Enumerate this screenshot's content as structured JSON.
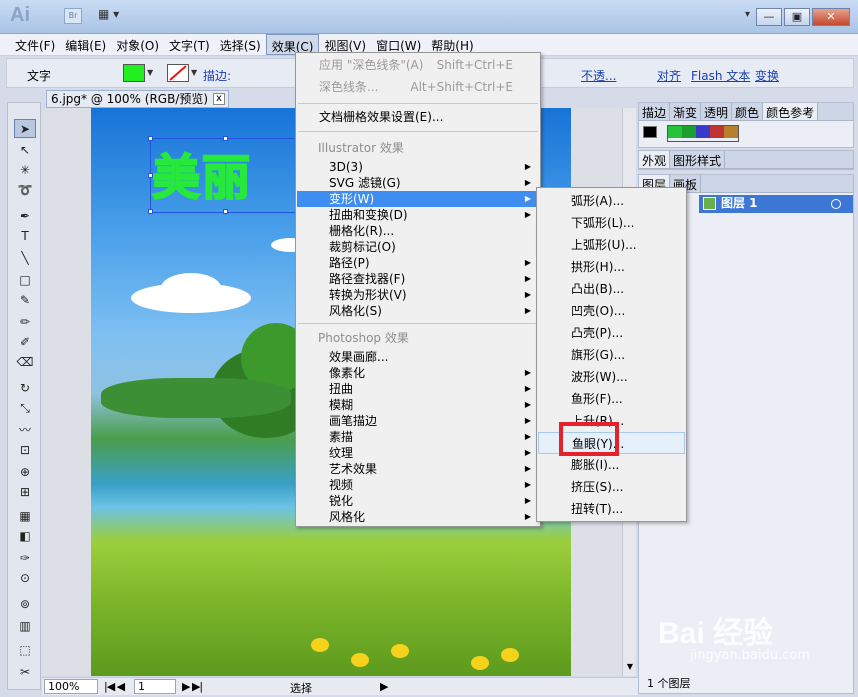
{
  "titlebar": {
    "logo": "Ai",
    "bridge": "Br",
    "arrange": "▦ ▾",
    "workspace_dropdown": "▾",
    "buttons": [
      "—",
      "▣",
      "✕"
    ]
  },
  "menubar": {
    "items": [
      "文件(F)",
      "编辑(E)",
      "对象(O)",
      "文字(T)",
      "选择(S)",
      "效果(C)",
      "视图(V)",
      "窗口(W)",
      "帮助(H)"
    ]
  },
  "control": {
    "type_label": "文字",
    "fill_color": "#22ee22",
    "stroke_label": "描边:",
    "opacity_link": "不透...",
    "align_link": "对齐",
    "flash_link": "Flash 文本",
    "transform_link": "变换"
  },
  "document": {
    "tab_title": "6.jpg* @ 100% (RGB/预览)",
    "close": "x",
    "text_preview": "美丽"
  },
  "status": {
    "zoom": "100%",
    "page": "1",
    "tool": "选择"
  },
  "panels": {
    "top_tabs": [
      "描边",
      "渐变",
      "透明",
      "颜色",
      "颜色参考"
    ],
    "colors": [
      "#000000",
      "#26c33a",
      "#1b9f2f",
      "#3b3bc8",
      "#c03333",
      "#b87f2e"
    ],
    "appearance_tabs": [
      "外观",
      "图形样式"
    ],
    "layer_tabs": [
      "图层",
      "画板"
    ],
    "layer_name": "图层 1",
    "layer_count": "1 个图层"
  },
  "effect_menu": {
    "apply_last": {
      "label": "应用 \"深色线条\"(A)",
      "shortcut": "Shift+Ctrl+E"
    },
    "last_effect": {
      "label": "深色线条...",
      "shortcut": "Alt+Shift+Ctrl+E"
    },
    "raster_settings": "文档栅格效果设置(E)...",
    "illustrator_header": "Illustrator 效果",
    "illustrator_items": [
      "3D(3)",
      "SVG 滤镜(G)",
      "变形(W)",
      "扭曲和变换(D)",
      "栅格化(R)...",
      "裁剪标记(O)",
      "路径(P)",
      "路径查找器(F)",
      "转换为形状(V)",
      "风格化(S)"
    ],
    "photoshop_header": "Photoshop 效果",
    "photoshop_items": [
      "效果画廊...",
      "像素化",
      "扭曲",
      "模糊",
      "画笔描边",
      "素描",
      "纹理",
      "艺术效果",
      "视频",
      "锐化",
      "风格化"
    ]
  },
  "warp_submenu": {
    "items": [
      "弧形(A)...",
      "下弧形(L)...",
      "上弧形(U)...",
      "拱形(H)...",
      "凸出(B)...",
      "凹壳(O)...",
      "凸壳(P)...",
      "旗形(G)...",
      "波形(W)...",
      "鱼形(F)...",
      "上升(R)...",
      "鱼眼(Y)...",
      "膨胀(I)...",
      "挤压(S)...",
      "扭转(T)..."
    ]
  },
  "watermark": {
    "brand": "Bai 经验",
    "url": "jingyan.baidu.com"
  }
}
